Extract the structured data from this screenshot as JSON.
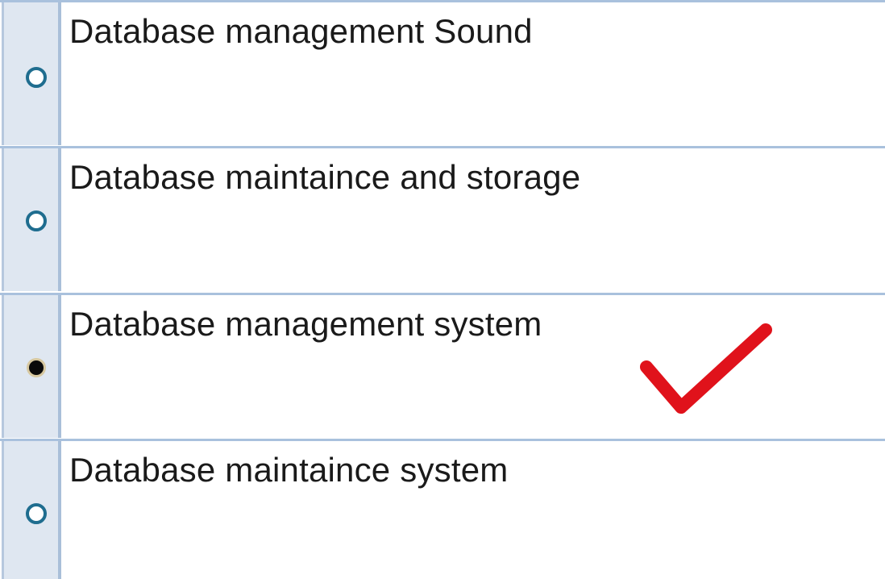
{
  "question": {
    "options": [
      {
        "label": "Database management Sound",
        "selected": false
      },
      {
        "label": "Database maintaince and storage",
        "selected": false
      },
      {
        "label": "Database management system",
        "selected": true
      },
      {
        "label": "Database maintaince system",
        "selected": false
      }
    ]
  },
  "annotation": {
    "icon": "checkmark-icon",
    "color": "#e0121b"
  },
  "colors": {
    "row_border": "#a9c1dd",
    "radio_cell_bg": "#dfe7f1",
    "radio_ring": "#1f6d8f"
  }
}
